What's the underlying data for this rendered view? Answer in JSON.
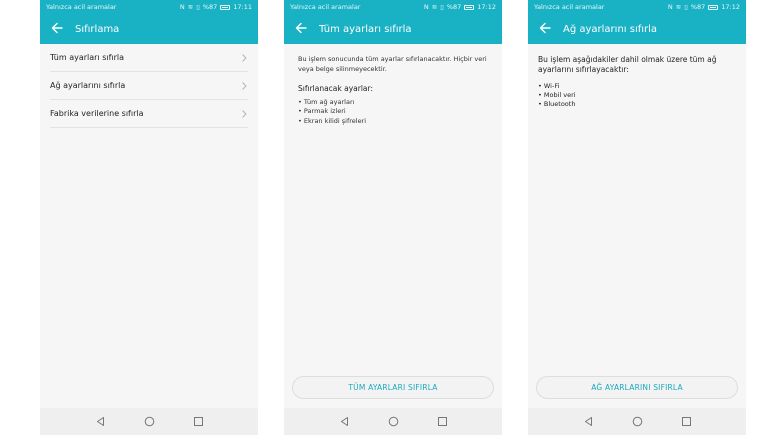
{
  "status_bar": {
    "carrier": "Yalnızca acil aramalar",
    "battery": "%87",
    "times": [
      "17:11",
      "17:12",
      "17:12"
    ]
  },
  "screens": [
    {
      "title": "Sıfırlama",
      "items": [
        {
          "label": "Tüm ayarları sıfırla"
        },
        {
          "label": "Ağ ayarlarını sıfırla"
        },
        {
          "label": "Fabrika verilerine sıfırla"
        }
      ]
    },
    {
      "title": "Tüm ayarları sıfırla",
      "description": "Bu işlem sonucunda tüm ayarlar sıfırlanacaktır. Hiçbir veri veya belge silinmeyecektir.",
      "section_title": "Sıfırlanacak ayarlar:",
      "bullets": [
        "• Tüm ağ ayarları",
        "• Parmak izleri",
        "• Ekran kilidi şifreleri"
      ],
      "button_label": "TÜM AYARLARI SIFIRLA"
    },
    {
      "title": "Ağ ayarlarını sıfırla",
      "description": "Bu işlem aşağıdakiler dahil olmak üzere tüm ağ ayarlarını sıfırlayacaktır:",
      "bullets": [
        "• Wi-Fi",
        "• Mobil veri",
        "• Bluetooth"
      ],
      "button_label": "AĞ AYARLARINI SIFIRLA"
    }
  ],
  "icons": {
    "back": "arrow-left-icon",
    "chevron": "chevron-right-icon",
    "nav_back": "triangle-back-icon",
    "nav_home": "circle-home-icon",
    "nav_recent": "square-recent-icon"
  },
  "colors": {
    "header": "#19b1c4",
    "accent_text": "#1aa9bd",
    "background": "#f6f6f6"
  }
}
